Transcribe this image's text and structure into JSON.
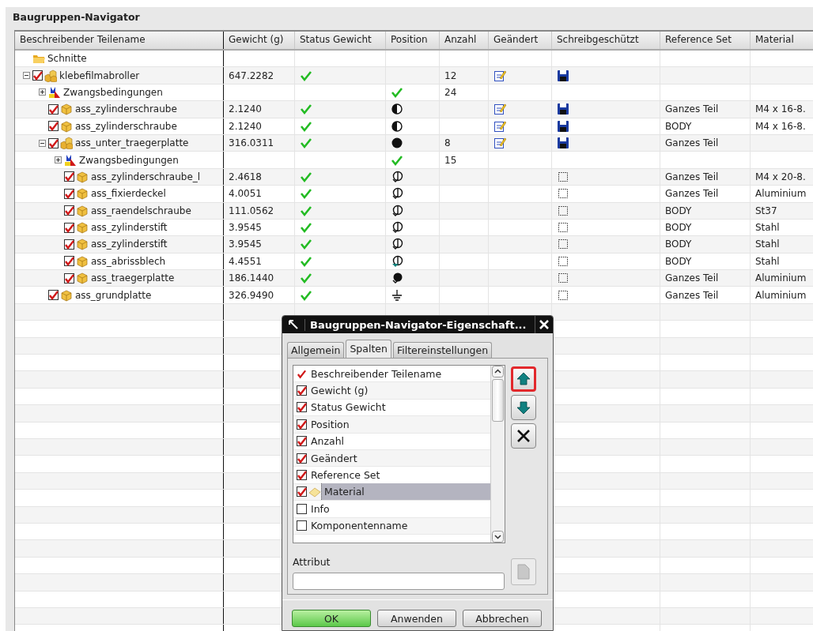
{
  "panel": {
    "title": "Baugruppen-Navigator"
  },
  "table": {
    "columns": [
      "Beschreibender Teilename",
      "Gewicht (g)",
      "Status Gewicht",
      "Position",
      "Anzahl",
      "Geändert",
      "Schreibgeschützt",
      "Reference Set",
      "Material"
    ],
    "rows": [
      {
        "kind": "folder",
        "name": "Schnitte"
      },
      {
        "kind": "assembly",
        "expanded": true,
        "checked": true,
        "name": "klebefilmabroller",
        "weight": "647.2282",
        "weight_ok": true,
        "count": "12",
        "changed": true,
        "write_protect": {
          "kind": "locked"
        },
        "children": [
          {
            "kind": "constraints",
            "expanded": false,
            "name": "Zwangsbedingungen",
            "position": {
              "kind": "check"
            },
            "count": "24"
          },
          {
            "kind": "part",
            "checked": true,
            "name": "ass_zylinderschraube",
            "weight": "2.1240",
            "weight_ok": true,
            "position": {
              "kind": "half"
            },
            "changed": true,
            "write_protect": {
              "kind": "locked"
            },
            "reference_set": "Ganzes Teil",
            "material": "M4 x 16-8."
          },
          {
            "kind": "part",
            "checked": true,
            "name": "ass_zylinderschraube",
            "weight": "2.1240",
            "weight_ok": true,
            "position": {
              "kind": "half"
            },
            "changed": true,
            "write_protect": {
              "kind": "locked"
            },
            "reference_set": "BODY",
            "material": "M4 x 16-8."
          },
          {
            "kind": "assembly",
            "expanded": true,
            "checked": true,
            "name": "ass_unter_traegerplatte",
            "weight": "316.0311",
            "weight_ok": true,
            "position": {
              "kind": "full"
            },
            "count": "8",
            "changed": true,
            "write_protect": {
              "kind": "locked"
            },
            "reference_set": "Ganzes Teil",
            "children": [
              {
                "kind": "constraints",
                "expanded": false,
                "name": "Zwangsbedingungen",
                "position": {
                  "kind": "check"
                },
                "count": "15"
              },
              {
                "kind": "part",
                "checked": true,
                "name": "ass_zylinderschraube_l",
                "weight": "2.4618",
                "weight_ok": true,
                "position": {
                  "kind": "partial"
                },
                "write_protect": {
                  "kind": "open"
                },
                "reference_set": "Ganzes Teil",
                "material": "M4 x 20-8."
              },
              {
                "kind": "part",
                "checked": true,
                "name": "ass_fixierdeckel",
                "weight": "4.0051",
                "weight_ok": true,
                "position": {
                  "kind": "partial"
                },
                "write_protect": {
                  "kind": "open"
                },
                "reference_set": "Ganzes Teil",
                "material": "Aluminium"
              },
              {
                "kind": "part",
                "checked": true,
                "name": "ass_raendelschraube",
                "weight": "111.0562",
                "weight_ok": true,
                "position": {
                  "kind": "partial"
                },
                "write_protect": {
                  "kind": "open"
                },
                "reference_set": "BODY",
                "material": "St37"
              },
              {
                "kind": "part",
                "checked": true,
                "name": "ass_zylinderstift",
                "weight": "3.9545",
                "weight_ok": true,
                "position": {
                  "kind": "partial"
                },
                "write_protect": {
                  "kind": "open"
                },
                "reference_set": "BODY",
                "material": "Stahl"
              },
              {
                "kind": "part",
                "checked": true,
                "name": "ass_zylinderstift",
                "weight": "3.9545",
                "weight_ok": true,
                "position": {
                  "kind": "partial"
                },
                "write_protect": {
                  "kind": "open"
                },
                "reference_set": "BODY",
                "material": "Stahl"
              },
              {
                "kind": "part",
                "checked": true,
                "name": "ass_abrissblech",
                "weight": "4.4551",
                "weight_ok": true,
                "position": {
                  "kind": "arrow"
                },
                "write_protect": {
                  "kind": "open"
                },
                "reference_set": "BODY",
                "material": "Stahl"
              },
              {
                "kind": "part",
                "checked": true,
                "name": "ass_traegerplatte",
                "weight": "186.1440",
                "weight_ok": true,
                "position": {
                  "kind": "mostly"
                },
                "write_protect": {
                  "kind": "open"
                },
                "reference_set": "Ganzes Teil",
                "material": "Aluminium"
              }
            ]
          },
          {
            "kind": "part",
            "checked": true,
            "name": "ass_grundplatte",
            "weight": "326.9490",
            "weight_ok": true,
            "position": {
              "kind": "ground"
            },
            "write_protect": {
              "kind": "open"
            },
            "reference_set": "Ganzes Teil",
            "material": "Aluminium"
          }
        ]
      }
    ]
  },
  "dialog": {
    "title": "Baugruppen-Navigator-Eigenschaft...",
    "tabs": [
      {
        "label": "Allgemein",
        "selected": false
      },
      {
        "label": "Spalten",
        "selected": true
      },
      {
        "label": "Filtereinstellungen",
        "selected": false
      }
    ],
    "columns": [
      {
        "kind": "fixed",
        "label": "Beschreibender Teilename",
        "selected": false
      },
      {
        "kind": "checkbox",
        "checked": true,
        "label": "Gewicht (g)",
        "selected": false
      },
      {
        "kind": "checkbox",
        "checked": true,
        "label": "Status Gewicht",
        "selected": false
      },
      {
        "kind": "checkbox",
        "checked": true,
        "label": "Position",
        "selected": false
      },
      {
        "kind": "checkbox",
        "checked": true,
        "label": "Anzahl",
        "selected": false
      },
      {
        "kind": "checkbox",
        "checked": true,
        "label": "Geändert",
        "selected": false
      },
      {
        "kind": "checkbox",
        "checked": true,
        "label": "Reference Set",
        "selected": false
      },
      {
        "kind": "checkbox",
        "checked": true,
        "label": "Material",
        "selected": true
      },
      {
        "kind": "checkbox",
        "checked": false,
        "label": "Info",
        "selected": false
      },
      {
        "kind": "checkbox",
        "checked": false,
        "label": "Komponentenname",
        "selected": false
      }
    ],
    "side_buttons": [
      {
        "kind": "up",
        "highlighted": true
      },
      {
        "kind": "down",
        "highlighted": false
      },
      {
        "kind": "remove",
        "highlighted": false
      }
    ],
    "attribute": {
      "label": "Attribut"
    },
    "buttons": [
      {
        "label": "OK",
        "default": true
      },
      {
        "label": "Anwenden",
        "default": false
      },
      {
        "label": "Abbrechen",
        "default": false
      }
    ]
  }
}
